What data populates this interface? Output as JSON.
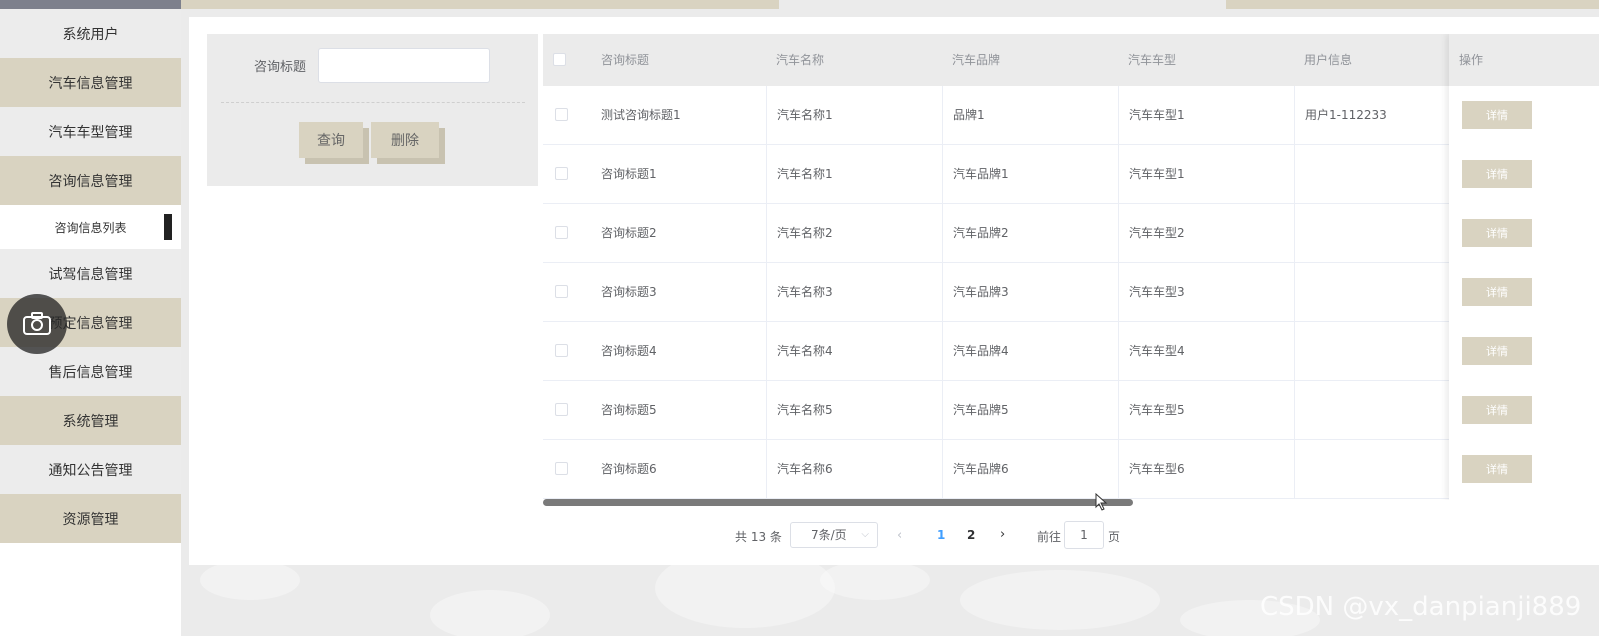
{
  "sidebar": {
    "items": [
      {
        "label": "系统用户"
      },
      {
        "label": "汽车信息管理"
      },
      {
        "label": "汽车车型管理"
      },
      {
        "label": "咨询信息管理"
      },
      {
        "label": "咨询信息列表"
      },
      {
        "label": "试驾信息管理"
      },
      {
        "label": "预定信息管理"
      },
      {
        "label": "售后信息管理"
      },
      {
        "label": "系统管理"
      },
      {
        "label": "通知公告管理"
      },
      {
        "label": "资源管理"
      }
    ]
  },
  "search": {
    "label": "咨询标题",
    "value": "",
    "query_button": "查询",
    "delete_button": "删除"
  },
  "table": {
    "headers": [
      "咨询标题",
      "汽车名称",
      "汽车品牌",
      "汽车车型",
      "用户信息",
      "操作"
    ],
    "rows": [
      {
        "title": "测试咨询标题1",
        "car_name": "汽车名称1",
        "brand": "品牌1",
        "model": "汽车车型1",
        "user": "用户1-112233",
        "action": "详情"
      },
      {
        "title": "咨询标题1",
        "car_name": "汽车名称1",
        "brand": "汽车品牌1",
        "model": "汽车车型1",
        "user": "",
        "action": "详情"
      },
      {
        "title": "咨询标题2",
        "car_name": "汽车名称2",
        "brand": "汽车品牌2",
        "model": "汽车车型2",
        "user": "",
        "action": "详情"
      },
      {
        "title": "咨询标题3",
        "car_name": "汽车名称3",
        "brand": "汽车品牌3",
        "model": "汽车车型3",
        "user": "",
        "action": "详情"
      },
      {
        "title": "咨询标题4",
        "car_name": "汽车名称4",
        "brand": "汽车品牌4",
        "model": "汽车车型4",
        "user": "",
        "action": "详情"
      },
      {
        "title": "咨询标题5",
        "car_name": "汽车名称5",
        "brand": "汽车品牌5",
        "model": "汽车车型5",
        "user": "",
        "action": "详情"
      },
      {
        "title": "咨询标题6",
        "car_name": "汽车名称6",
        "brand": "汽车品牌6",
        "model": "汽车车型6",
        "user": "",
        "action": "详情"
      }
    ]
  },
  "pagination": {
    "total": "共 13 条",
    "page_size": "7条/页",
    "pages": [
      "1",
      "2"
    ],
    "current_page": "1",
    "goto_label": "前往",
    "goto_value": "1",
    "page_suffix": "页"
  },
  "watermark": "CSDN @vx_danpianji889",
  "colors": {
    "accent": "#d9d3c1",
    "sidebar_dark": "#7d808c",
    "active_page": "#409eff"
  }
}
